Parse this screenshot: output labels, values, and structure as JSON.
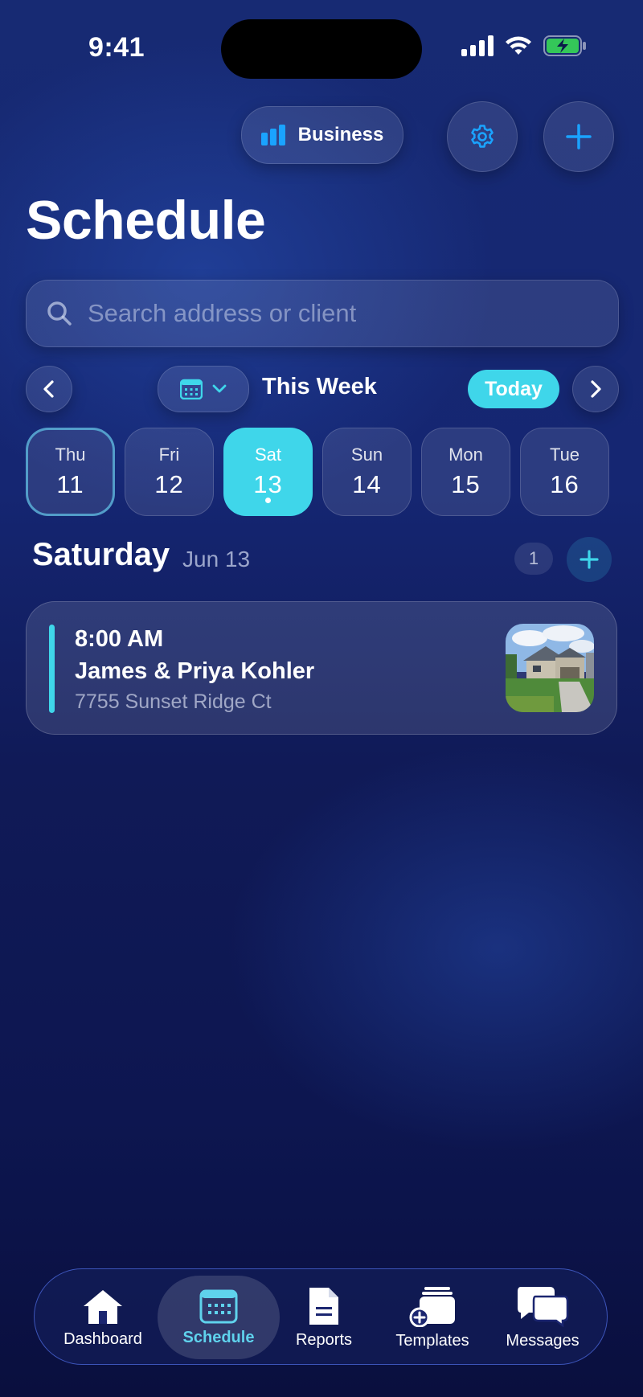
{
  "status_bar": {
    "time": "9:41"
  },
  "header": {
    "account_label": "Business",
    "title": "Schedule"
  },
  "search": {
    "placeholder": "Search address or client"
  },
  "week_nav": {
    "label": "This Week",
    "today_label": "Today"
  },
  "days": [
    {
      "name": "Thu",
      "date": "11",
      "state": "today"
    },
    {
      "name": "Fri",
      "date": "12",
      "state": "normal"
    },
    {
      "name": "Sat",
      "date": "13",
      "state": "selected",
      "has_event": true
    },
    {
      "name": "Sun",
      "date": "14",
      "state": "normal"
    },
    {
      "name": "Mon",
      "date": "15",
      "state": "normal"
    },
    {
      "name": "Tue",
      "date": "16",
      "state": "normal"
    }
  ],
  "section": {
    "day": "Saturday",
    "date": "Jun 13",
    "count": "1"
  },
  "appointments": [
    {
      "time": "8:00 AM",
      "client": "James & Priya Kohler",
      "address": "7755 Sunset Ridge Ct"
    }
  ],
  "tabs": [
    {
      "label": "Dashboard",
      "icon": "house-icon"
    },
    {
      "label": "Schedule",
      "icon": "calendar-icon",
      "active": true
    },
    {
      "label": "Reports",
      "icon": "document-icon"
    },
    {
      "label": "Templates",
      "icon": "templates-stack-icon"
    },
    {
      "label": "Messages",
      "icon": "chat-bubbles-icon"
    }
  ],
  "colors": {
    "accent": "#3fd6ea",
    "icon_blue": "#1aa3ff",
    "battery_green": "#34c759"
  }
}
